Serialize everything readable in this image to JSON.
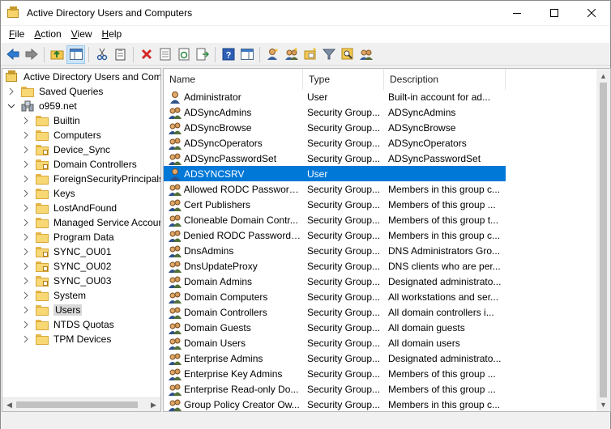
{
  "window": {
    "title": "Active Directory Users and Computers"
  },
  "menu": [
    {
      "key": "F",
      "rest": "ile"
    },
    {
      "key": "A",
      "rest": "ction"
    },
    {
      "key": "V",
      "rest": "iew"
    },
    {
      "key": "H",
      "rest": "elp"
    }
  ],
  "toolbar": [
    "back-icon",
    "forward-icon",
    "up-folder-icon",
    "show-tree-icon",
    "cut-icon",
    "paste-icon",
    "delete-icon",
    "properties-icon",
    "refresh-icon",
    "export-list-icon",
    "help-icon",
    "show-pane-icon",
    "new-user-icon",
    "new-group-icon",
    "new-ou-icon",
    "filter-icon",
    "find-icon",
    "add-to-group-icon"
  ],
  "tree": {
    "root": "Active Directory Users and Com",
    "saved_queries": "Saved Queries",
    "domain": "o959.net",
    "items": [
      {
        "label": "Builtin",
        "locked": false
      },
      {
        "label": "Computers",
        "locked": false
      },
      {
        "label": "Device_Sync",
        "locked": true
      },
      {
        "label": "Domain Controllers",
        "locked": true
      },
      {
        "label": "ForeignSecurityPrincipals",
        "locked": false
      },
      {
        "label": "Keys",
        "locked": false
      },
      {
        "label": "LostAndFound",
        "locked": false
      },
      {
        "label": "Managed Service Accoun",
        "locked": false
      },
      {
        "label": "Program Data",
        "locked": false
      },
      {
        "label": "SYNC_OU01",
        "locked": true
      },
      {
        "label": "SYNC_OU02",
        "locked": true
      },
      {
        "label": "SYNC_OU03",
        "locked": true
      },
      {
        "label": "System",
        "locked": false
      },
      {
        "label": "Users",
        "locked": false,
        "selected": true
      },
      {
        "label": "NTDS Quotas",
        "locked": false
      },
      {
        "label": "TPM Devices",
        "locked": false
      }
    ]
  },
  "list": {
    "columns": [
      "Name",
      "Type",
      "Description"
    ],
    "rows": [
      {
        "icon": "user-icon",
        "name": "Administrator",
        "type": "User",
        "desc": "Built-in account for ad..."
      },
      {
        "icon": "group-icon",
        "name": "ADSyncAdmins",
        "type": "Security Group...",
        "desc": "ADSyncAdmins"
      },
      {
        "icon": "group-icon",
        "name": "ADSyncBrowse",
        "type": "Security Group...",
        "desc": "ADSyncBrowse"
      },
      {
        "icon": "group-icon",
        "name": "ADSyncOperators",
        "type": "Security Group...",
        "desc": "ADSyncOperators"
      },
      {
        "icon": "group-icon",
        "name": "ADSyncPasswordSet",
        "type": "Security Group...",
        "desc": "ADSyncPasswordSet"
      },
      {
        "icon": "user-icon",
        "name": "ADSYNCSRV",
        "type": "User",
        "desc": "",
        "selected": true
      },
      {
        "icon": "group-icon",
        "name": "Allowed RODC Password ...",
        "type": "Security Group...",
        "desc": "Members in this group c..."
      },
      {
        "icon": "group-icon",
        "name": "Cert Publishers",
        "type": "Security Group...",
        "desc": "Members of this group ..."
      },
      {
        "icon": "group-icon",
        "name": "Cloneable Domain Contr...",
        "type": "Security Group...",
        "desc": "Members of this group t..."
      },
      {
        "icon": "group-icon",
        "name": "Denied RODC Password R...",
        "type": "Security Group...",
        "desc": "Members in this group c..."
      },
      {
        "icon": "group-icon",
        "name": "DnsAdmins",
        "type": "Security Group...",
        "desc": "DNS Administrators Gro..."
      },
      {
        "icon": "group-icon",
        "name": "DnsUpdateProxy",
        "type": "Security Group...",
        "desc": "DNS clients who are per..."
      },
      {
        "icon": "group-icon",
        "name": "Domain Admins",
        "type": "Security Group...",
        "desc": "Designated administrato..."
      },
      {
        "icon": "group-icon",
        "name": "Domain Computers",
        "type": "Security Group...",
        "desc": "All workstations and ser..."
      },
      {
        "icon": "group-icon",
        "name": "Domain Controllers",
        "type": "Security Group...",
        "desc": "All domain controllers i..."
      },
      {
        "icon": "group-icon",
        "name": "Domain Guests",
        "type": "Security Group...",
        "desc": "All domain guests"
      },
      {
        "icon": "group-icon",
        "name": "Domain Users",
        "type": "Security Group...",
        "desc": "All domain users"
      },
      {
        "icon": "group-icon",
        "name": "Enterprise Admins",
        "type": "Security Group...",
        "desc": "Designated administrato..."
      },
      {
        "icon": "group-icon",
        "name": "Enterprise Key Admins",
        "type": "Security Group...",
        "desc": "Members of this group ..."
      },
      {
        "icon": "group-icon",
        "name": "Enterprise Read-only Do...",
        "type": "Security Group...",
        "desc": "Members of this group ..."
      },
      {
        "icon": "group-icon",
        "name": "Group Policy Creator Ow...",
        "type": "Security Group...",
        "desc": "Members in this group c..."
      }
    ]
  },
  "colors": {
    "selection": "#0078d7",
    "folder": "#f8d775"
  }
}
